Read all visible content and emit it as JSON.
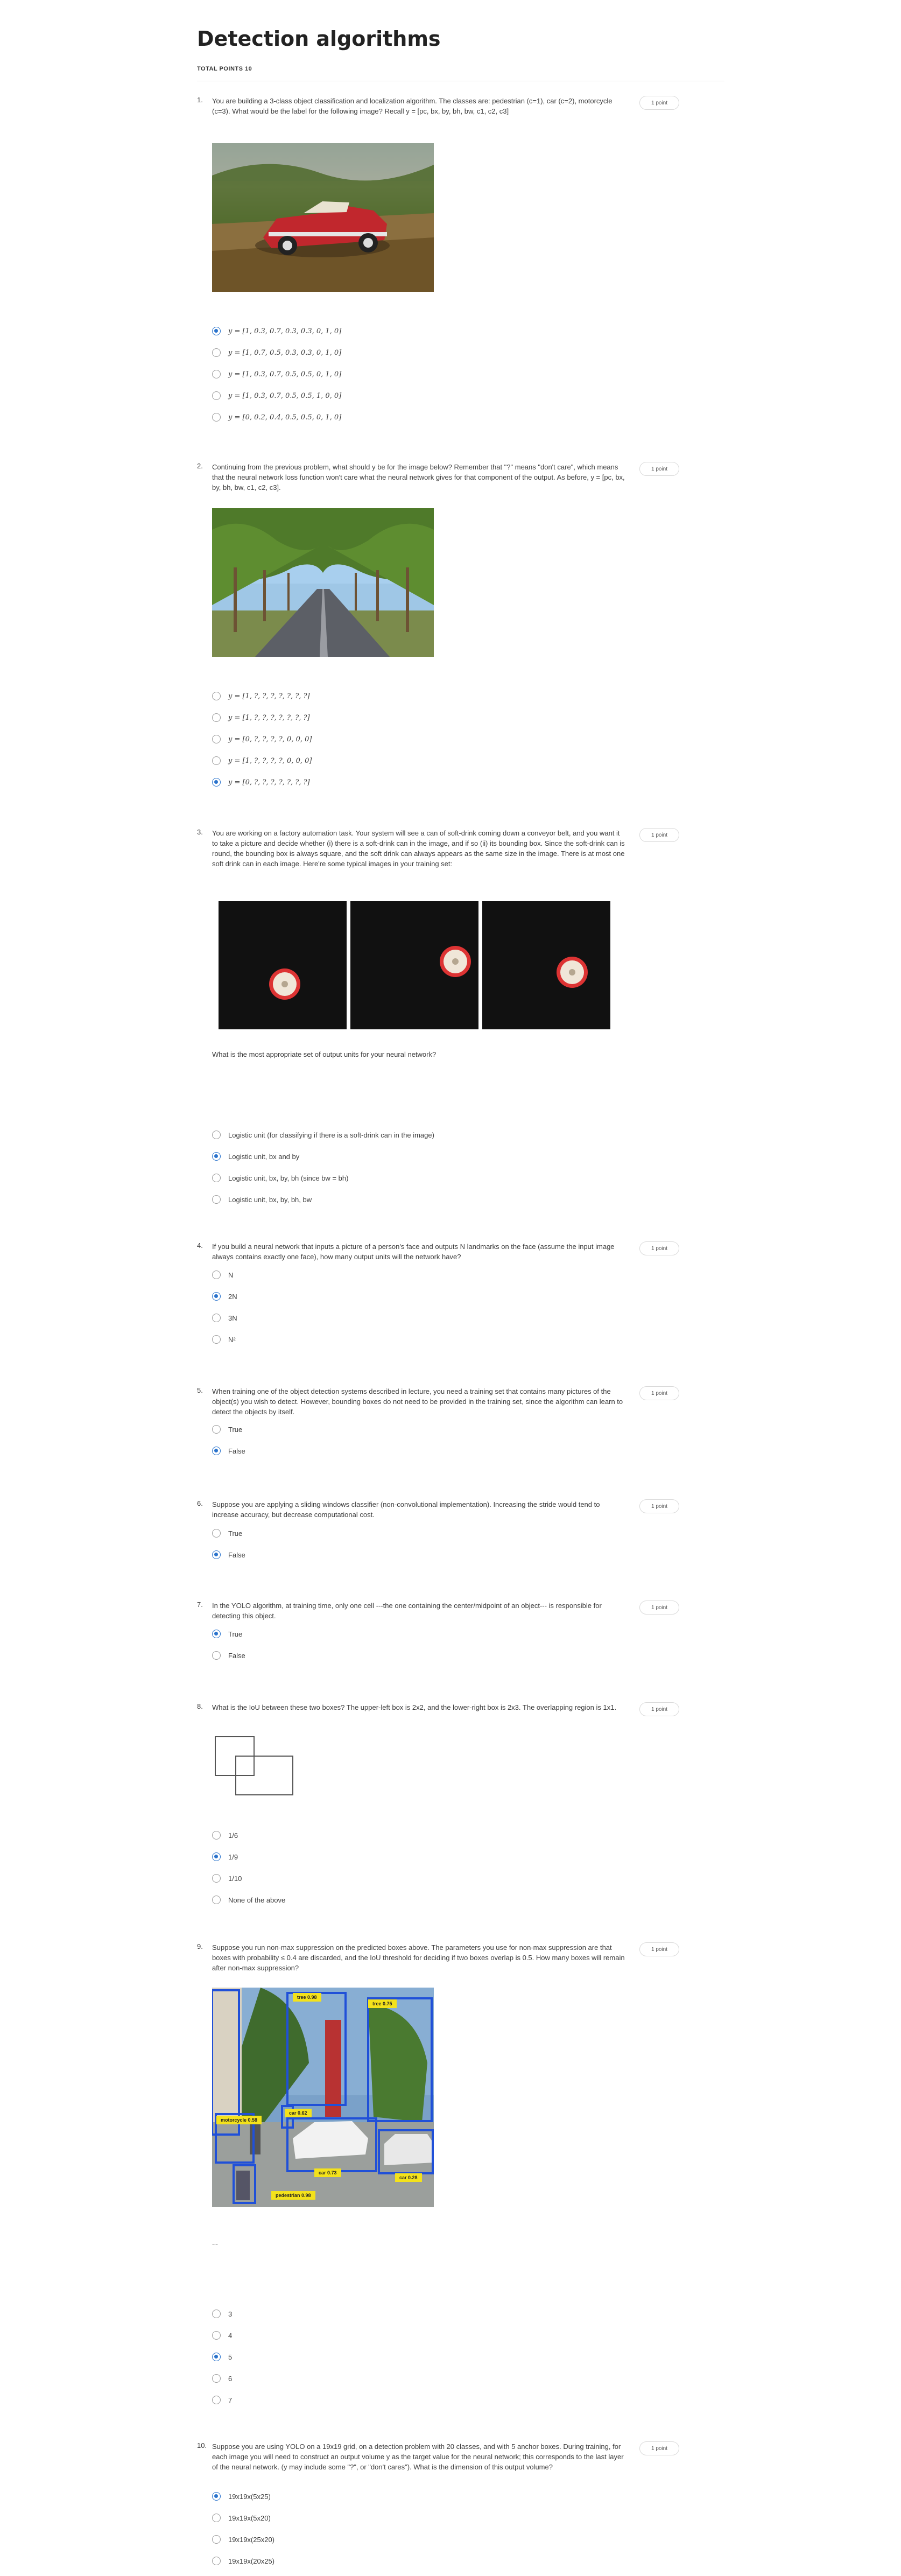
{
  "quiz": {
    "title": "Detection algorithms",
    "total_points": "TOTAL POINTS 10",
    "point_label": "1 point",
    "questions": [
      {
        "num": "1.",
        "text": "You are building a 3-class object classification and localization algorithm. The classes are: pedestrian (c=1), car (c=2), motorcycle (c=3). What would be the label for the following image? Recall y = [pc, bx, by, bh, bw, c1, c2, c3]",
        "image": "red-vintage-car-photo",
        "options": [
          "y = [1, 0.3, 0.7, 0.3, 0.3, 0, 1, 0]",
          "y = [1, 0.7, 0.5, 0.3, 0.3, 0, 1, 0]",
          "y = [1, 0.3, 0.7, 0.5, 0.5, 0, 1, 0]",
          "y = [1, 0.3, 0.7, 0.5, 0.5, 1, 0, 0]",
          "y = [0, 0.2, 0.4, 0.5, 0.5, 0, 1, 0]"
        ],
        "selected": 0
      },
      {
        "num": "2.",
        "text": "Continuing from the previous problem, what should y be for the image below? Remember that \"?\" means \"don't care\", which means that the neural network loss function won't care what the neural network gives for that component of the output. As before, y = [pc, bx, by, bh, bw, c1, c2, c3].",
        "image": "tree-lined-road-photo",
        "options": [
          "y = [1, ?, ?, ?, ?, ?, ?, ?]",
          "y = [1, ?, ?, ?, ?, ?, ?, ?]",
          "y = [0, ?, ?, ?, ?, 0, 0, 0]",
          "y = [1, ?, ?, ?, ?, 0, 0, 0]",
          "y = [0, ?, ?, ?, ?, ?, ?, ?]"
        ],
        "selected": 4
      },
      {
        "num": "3.",
        "text": "You are working on a factory automation task. Your system will see a can of soft-drink coming down a conveyor belt, and you want it to take a picture and decide whether (i) there is a soft-drink can in the image, and if so (ii) its bounding box. Since the soft-drink can is round, the bounding box is always square, and the soft drink can always appears as the same size in the image. There is at most one soft drink can in each image. Here're some typical images in your training set:",
        "subtext": "What is the most appropriate set of output units for your neural network?",
        "options": [
          "Logistic unit (for classifying if there is a soft-drink can in the image)",
          "Logistic unit, bx and by",
          "Logistic unit, bx, by, bh (since bw = bh)",
          "Logistic unit, bx, by, bh, bw"
        ],
        "selected": 1
      },
      {
        "num": "4.",
        "text": "If you build a neural network that inputs a picture of a person's face and outputs N landmarks on the face (assume the input image always contains exactly one face), how many output units will the network have?",
        "options": [
          "N",
          "2N",
          "3N",
          "N²"
        ],
        "selected": 1
      },
      {
        "num": "5.",
        "text": "When training one of the object detection systems described in lecture, you need a training set that contains many pictures of the object(s) you wish to detect. However, bounding boxes do not need to be provided in the training set, since the algorithm can learn to detect the objects by itself.",
        "options": [
          "True",
          "False"
        ],
        "selected": 1
      },
      {
        "num": "6.",
        "text": "Suppose you are applying a sliding windows classifier (non-convolutional implementation). Increasing the stride would tend to increase accuracy, but decrease computational cost.",
        "options": [
          "True",
          "False"
        ],
        "selected": 1
      },
      {
        "num": "7.",
        "text": "In the YOLO algorithm, at training time, only one cell ---the one containing the center/midpoint of an object--- is responsible for detecting this object.",
        "options": [
          "True",
          "False"
        ],
        "selected": 0
      },
      {
        "num": "8.",
        "text": "What is the IoU between these two boxes? The upper-left box is 2x2, and the lower-right box is 2x3. The overlapping region is 1x1.",
        "options": [
          "1/6",
          "1/9",
          "1/10",
          "None of the above"
        ],
        "selected": 1
      },
      {
        "num": "9.",
        "text": "Suppose you run non-max suppression on the predicted boxes above. The parameters you use for non-max suppression are that boxes with probability ≤ 0.4 are discarded, and the IoU threshold for deciding if two boxes overlap is 0.5. How many boxes will remain after non-max suppression?",
        "ellipsis": "...",
        "detections": [
          "tree 0.98",
          "tree 0.75",
          "car 0.62",
          "motorcycle 0.58",
          "car 0.73",
          "car 0.28",
          "pedestrian 0.98"
        ],
        "options": [
          "3",
          "4",
          "5",
          "6",
          "7"
        ],
        "selected": 2
      },
      {
        "num": "10.",
        "text": "Suppose you are using YOLO on a 19x19 grid, on a detection problem with 20 classes, and with 5 anchor boxes. During training, for each image you will need to construct an output volume y as the target value for the neural network; this corresponds to the last layer of the neural network. (y may include some \"?\", or \"don't cares\"). What is the dimension of this output volume?",
        "options": [
          "19x19x(5x25)",
          "19x19x(5x20)",
          "19x19x(25x20)",
          "19x19x(20x25)"
        ],
        "selected": 0
      }
    ]
  },
  "colors": {
    "accent": "#2a73cc",
    "text": "#3c3c3c",
    "border": "#d9d9d9"
  }
}
